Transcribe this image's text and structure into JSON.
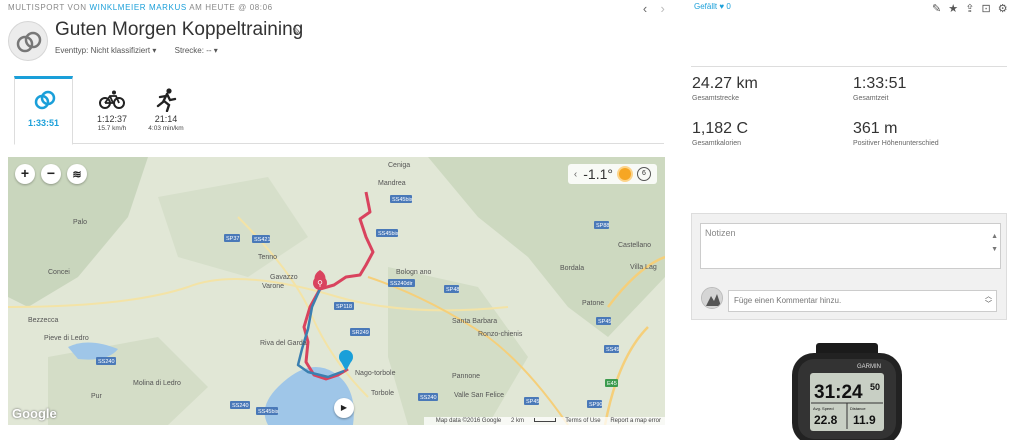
{
  "header": {
    "prefix": "MULTISPORT VON",
    "author": "WINKLMEIER MARKUS",
    "suffix": "AM HEUTE @ 08:06",
    "prev_icon": "chevron-left",
    "next_icon": "chevron-right",
    "title": "Guten Morgen Koppeltraining",
    "event_type": "Eventtyp: Nicht klassifiziert ▾",
    "course": "Strecke: -- ▾"
  },
  "tabs": [
    {
      "icon": "multisport-icon",
      "value": "1:33:51",
      "sub": ""
    },
    {
      "icon": "bike-icon",
      "value": "1:12:37",
      "sub": "15.7 km/h"
    },
    {
      "icon": "run-icon",
      "value": "21:14",
      "sub": "4:03 min/km"
    }
  ],
  "map": {
    "zoom_in": "+",
    "zoom_out": "−",
    "temperature": "-1.1°",
    "wind": "6",
    "logo": "Google",
    "map_data": "Map data ©2016 Google",
    "scale": "2 km",
    "terms": "Terms of Use",
    "report": "Report a map error",
    "places": [
      "Ceniga",
      "Mandrea",
      "SS45bis",
      "SS45bis",
      "SP88",
      "Castellano",
      "Palo",
      "SP37",
      "SS421",
      "Tenno",
      "Gavazzo",
      "Varone",
      "SS240dir",
      "Bologn ano",
      "Bordala",
      "Villa Lag",
      "Concei",
      "SP48",
      "SP118",
      "Patone",
      "Bezzecca",
      "SP45",
      "Santa Barbara",
      "SR249",
      "Ronzo-chienis",
      "Pieve di Ledro",
      "Riva del Garda",
      "SS45",
      "SS240",
      "Nago-torbole",
      "Pannone",
      "Molina di Ledro",
      "Torbole",
      "Valle San Felice",
      "Pur",
      "SS240",
      "SS45bis",
      "SS240",
      "SP45",
      "SP90",
      "E45"
    ]
  },
  "right": {
    "like_label": "Gefällt",
    "like_count": "0",
    "stats": [
      {
        "value": "24.27 km",
        "label": "Gesamtstrecke"
      },
      {
        "value": "1:33:51",
        "label": "Gesamtzeit"
      },
      {
        "value": "1,182 C",
        "label": "Gesamtkalorien"
      },
      {
        "value": "361 m",
        "label": "Positiver Höhenunterschied"
      }
    ],
    "notes_placeholder": "Notizen",
    "comment_placeholder": "Füge einen Kommentar hinzu."
  },
  "watch": {
    "brand": "GARMIN",
    "time_main": "31:24",
    "time_sec": "50",
    "field1_label": "Avg. Speed",
    "field1_value": "22.8",
    "field2_label": "Distance",
    "field2_value": "11.9"
  },
  "colors": {
    "accent": "#1a9fd9",
    "bike_route": "#d9435e",
    "run_route": "#3b7fb0"
  }
}
